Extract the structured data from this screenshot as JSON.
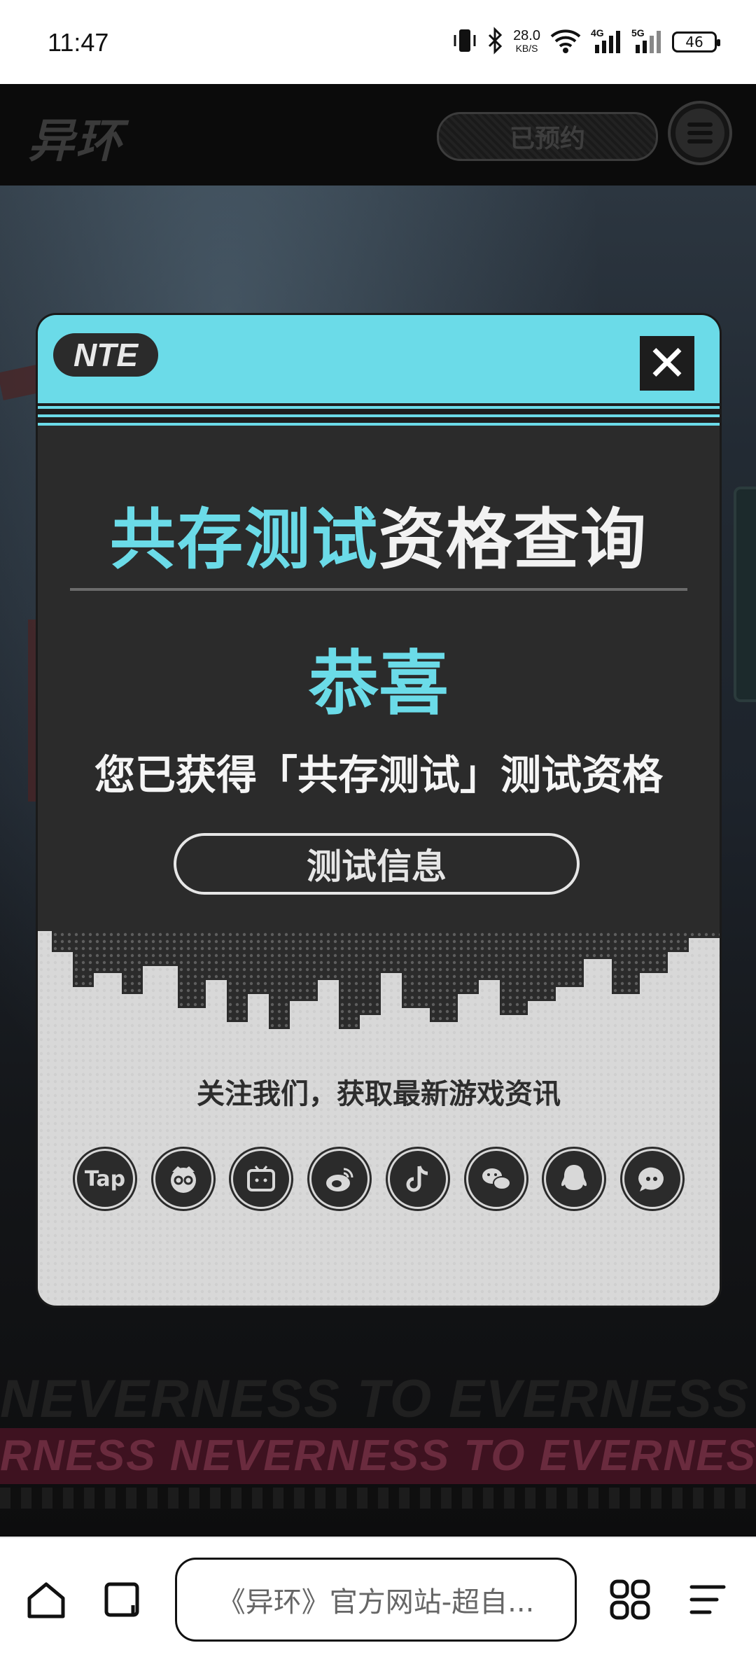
{
  "status_bar": {
    "time": "11:47",
    "net_speed_value": "28.0",
    "net_speed_unit": "KB/S",
    "sig1_label": "4G",
    "sig2_label": "5G",
    "battery": "46",
    "icons": [
      "vibrate-icon",
      "bluetooth-icon",
      "wifi-icon",
      "signal-4g-icon",
      "signal-5g-icon",
      "battery-icon"
    ]
  },
  "header": {
    "logo": "异环",
    "reserved_label": "已预约"
  },
  "modal": {
    "badge": "NTE",
    "close_label": "✕",
    "title_highlight": "共存测试",
    "title_rest": "资格查询",
    "congrats": "恭喜",
    "qualification_text": "您已获得「共存测试」测试资格",
    "info_button": "测试信息",
    "follow_text": "关注我们，获取最新游戏资讯",
    "socials": [
      {
        "name": "taptap",
        "label": "Tap"
      },
      {
        "name": "hykb",
        "label": ""
      },
      {
        "name": "bilibili",
        "label": ""
      },
      {
        "name": "weibo",
        "label": ""
      },
      {
        "name": "douyin",
        "label": ""
      },
      {
        "name": "wechat",
        "label": ""
      },
      {
        "name": "qq",
        "label": ""
      },
      {
        "name": "community",
        "label": ""
      }
    ]
  },
  "background": {
    "banner_dark": "NEVERNESS TO EVERNESS NEVERNESS TO EVERNESS",
    "banner_pink": "RNESS  NEVERNESS TO EVERNESS  NEVER"
  },
  "browser": {
    "url_title": "《异环》官方网站-超自..."
  },
  "colors": {
    "accent_cyan": "#6bdbe8",
    "modal_bg": "#2b2b2b",
    "header_bg": "#0b0b0b"
  }
}
